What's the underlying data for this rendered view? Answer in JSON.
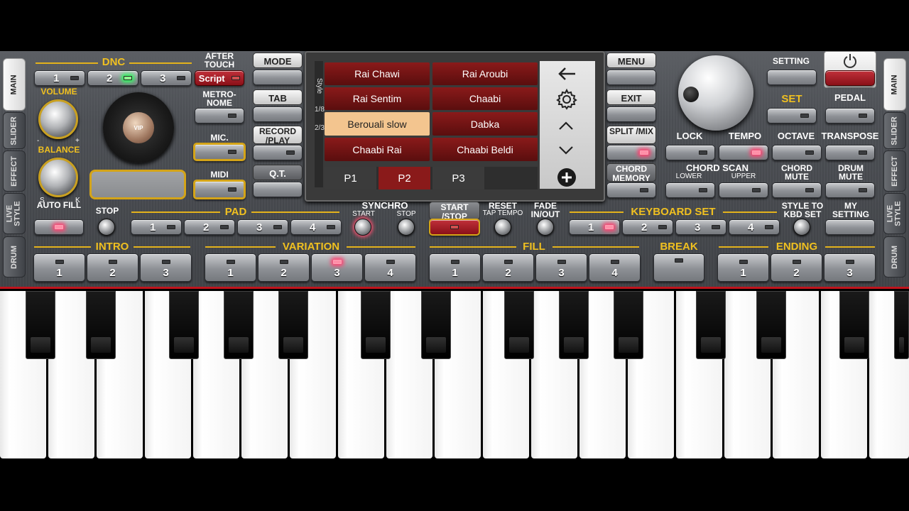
{
  "side_tabs_left": [
    "MAIN",
    "SLIDER",
    "EFFECT",
    "LIVE STYLE",
    "DRUM"
  ],
  "side_tabs_right": [
    "MAIN",
    "SLIDER",
    "EFFECT",
    "LIVE STYLE",
    "DRUM"
  ],
  "dnc": {
    "label": "DNC",
    "buttons": [
      "1",
      "2",
      "3"
    ],
    "script_label": "Script"
  },
  "after_touch": "AFTER TOUCH",
  "metronome": "METRO- NOME",
  "mic": "MIC.",
  "midi": "MIDI",
  "volume": "VOLUME",
  "balance": "BALANCE",
  "balance_s": "S",
  "balance_k": "K",
  "knob_minus": "-",
  "knob_plus": "+",
  "vip_badge": "VIP",
  "mid_left_buttons": {
    "mode": "MODE",
    "tab": "TAB",
    "record": "RECORD /PLAY",
    "qt": "Q.T."
  },
  "display": {
    "side_text_top": "Style",
    "side_text_mid": "1/8",
    "side_text_bot": "2/3",
    "styles": [
      [
        "Rai Chawi",
        "Rai Aroubi"
      ],
      [
        "Rai Sentim",
        "Chaabi"
      ],
      [
        "Berouali slow",
        "Dabka"
      ],
      [
        "Chaabi Rai",
        "Chaabi Beldi"
      ]
    ],
    "selected_style": "Berouali slow",
    "pages": [
      "P1",
      "P2",
      "P3"
    ],
    "selected_page": "P2"
  },
  "mid_right_buttons": {
    "menu": "MENU",
    "exit": "EXIT",
    "split": "SPLIT /MIX",
    "chord_memory": "CHORD MEMORY"
  },
  "right": {
    "setting": "SETTING",
    "set": "SET",
    "pedal": "PEDAL",
    "lock": "LOCK",
    "tempo": "TEMPO",
    "octave": "OCTAVE",
    "transpose": "TRANSPOSE",
    "chord_scan": "CHORD SCAN",
    "lower": "LOWER",
    "upper": "UPPER",
    "chord_mute": "CHORD MUTE",
    "drum_mute": "DRUM MUTE"
  },
  "row2": {
    "auto_fill": "AUTO FILL",
    "stop": "STOP",
    "pad": "PAD",
    "pad_buttons": [
      "1",
      "2",
      "3",
      "4"
    ],
    "synchro": "SYNCHRO",
    "synchro_start": "START",
    "synchro_stop": "STOP",
    "start_stop": "START /STOP",
    "reset": "RESET",
    "tap_tempo": "TAP TEMPO",
    "fade": "FADE IN/OUT",
    "keyboard_set": "KEYBOARD SET",
    "kbd_buttons": [
      "1",
      "2",
      "3",
      "4"
    ],
    "style_to_kbd": "STYLE TO KBD SET",
    "my_setting": "MY SETTING"
  },
  "row3": {
    "intro": "INTRO",
    "intro_buttons": [
      "1",
      "2",
      "3"
    ],
    "variation": "VARIATION",
    "variation_buttons": [
      "1",
      "2",
      "3",
      "4"
    ],
    "fill": "FILL",
    "fill_buttons": [
      "1",
      "2",
      "3",
      "4"
    ],
    "break": "BREAK",
    "ending": "ENDING",
    "ending_buttons": [
      "1",
      "2",
      "3"
    ]
  },
  "colors": {
    "accent": "#e3b21c",
    "selected": "#f3c58f",
    "style_bg": "#8a1a1a",
    "keyboard_line": "#c0141c"
  }
}
